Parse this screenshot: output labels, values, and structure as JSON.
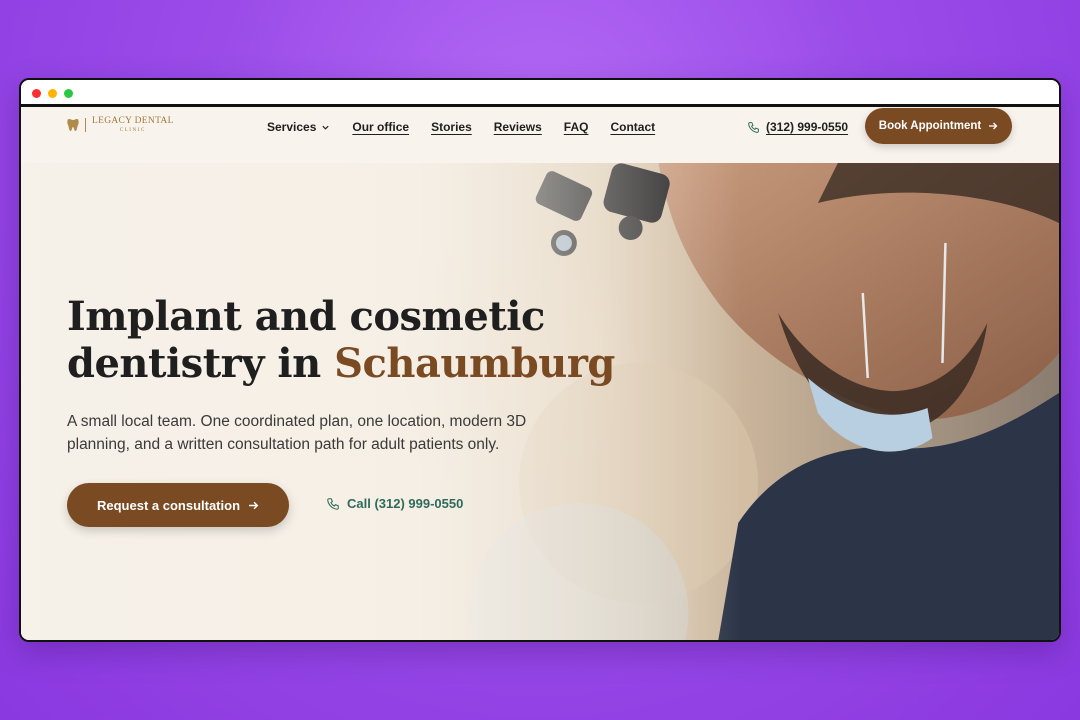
{
  "logo": {
    "line1": "LEGACY DENTAL",
    "line2": "CLINIC",
    "mark_icon": "tooth-icon"
  },
  "nav": {
    "services": "Services",
    "our_office": "Our office",
    "stories": "Stories",
    "reviews": "Reviews",
    "faq": "FAQ",
    "contact": "Contact",
    "phone": "(312) 999-0550",
    "book_button": "Book Appointment"
  },
  "hero": {
    "title_part1": "Implant and cosmetic",
    "title_part2": "dentistry in ",
    "title_accent": "Schaumburg",
    "subtitle": "A small local team. One coordinated plan, one location, modern 3D planning, and a written consultation path for adult patients only.",
    "cta_button": "Request a consultation",
    "call_link": "Call (312) 999-0550"
  },
  "colors": {
    "brand_brown": "#7a4a22",
    "accent_green": "#2f6b5a",
    "background_purple": "#9a4be8",
    "page_cream": "#f7f2ea"
  }
}
